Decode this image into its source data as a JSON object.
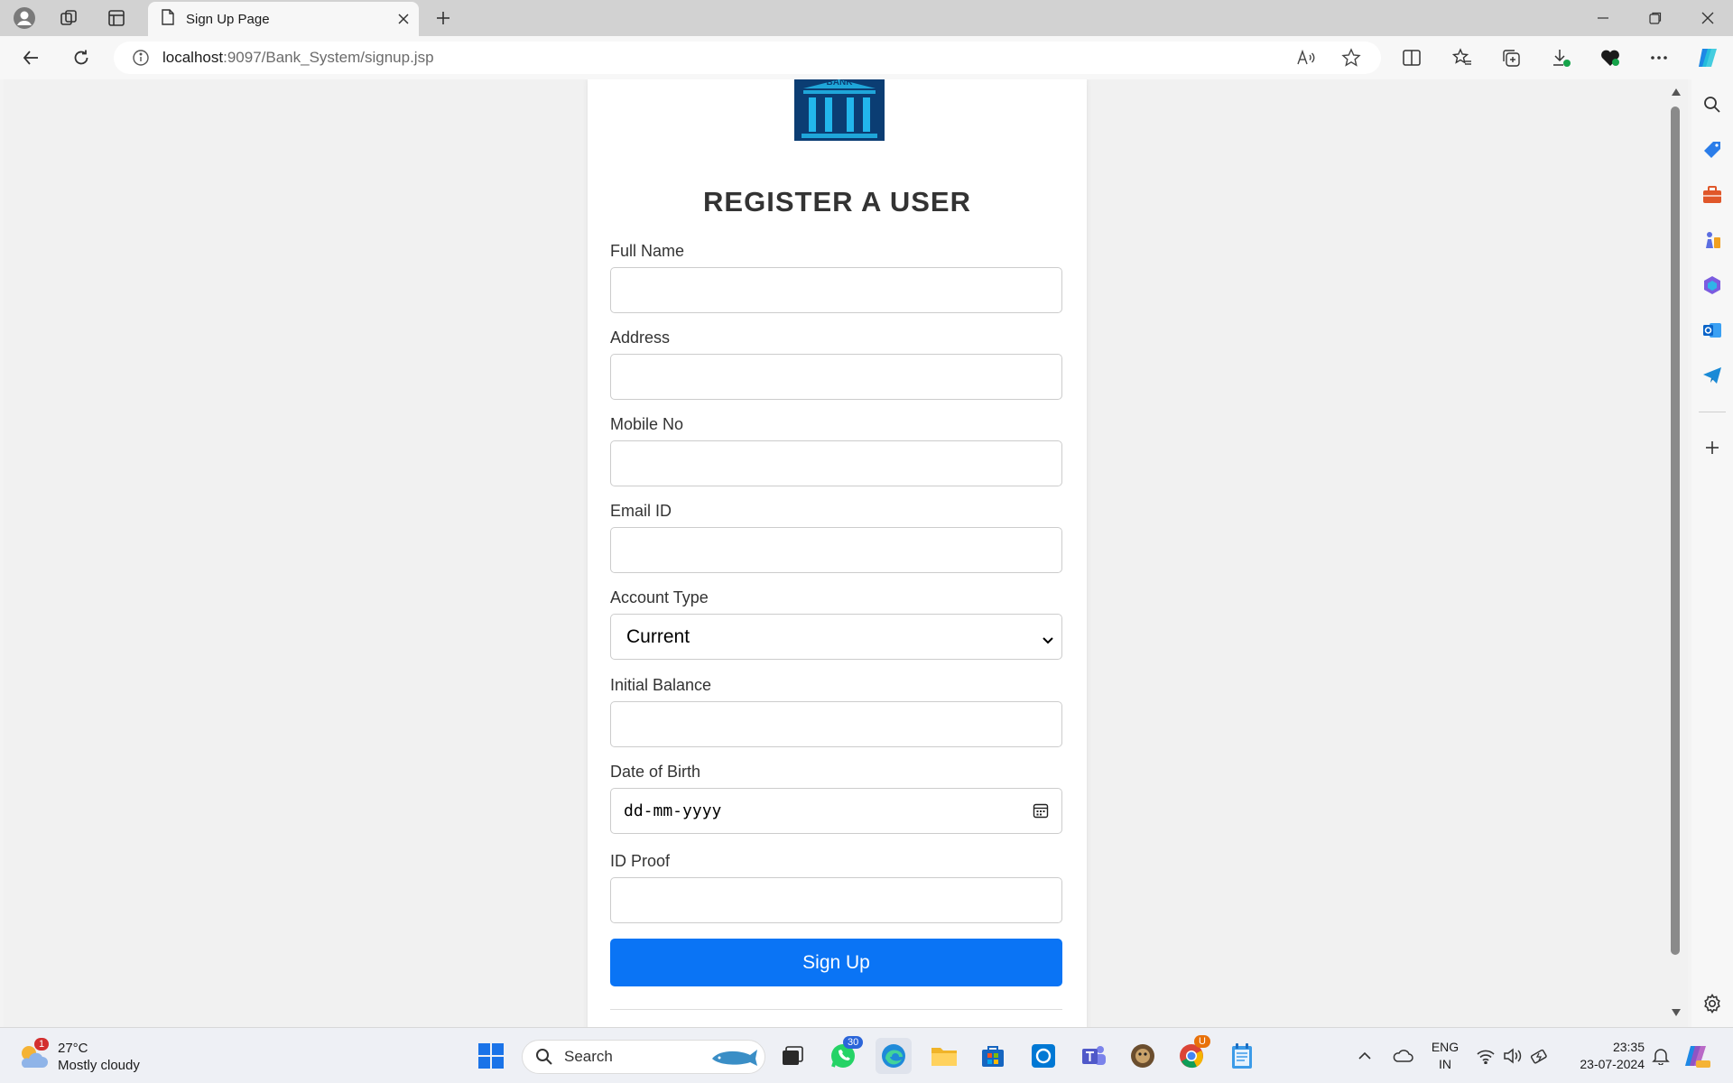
{
  "browser": {
    "tab_title": "Sign Up Page",
    "url_host": "localhost",
    "url_path": ":9097/Bank_System/signup.jsp"
  },
  "page": {
    "logo_text": "BANK",
    "heading": "REGISTER A USER",
    "fields": {
      "full_name": {
        "label": "Full Name",
        "value": ""
      },
      "address": {
        "label": "Address",
        "value": ""
      },
      "mobile": {
        "label": "Mobile No",
        "value": ""
      },
      "email": {
        "label": "Email ID",
        "value": ""
      },
      "account_type": {
        "label": "Account Type",
        "value": "Current"
      },
      "initial_balance": {
        "label": "Initial Balance",
        "value": ""
      },
      "dob": {
        "label": "Date of Birth",
        "placeholder": "dd-mm-yyyy"
      },
      "id_proof": {
        "label": "ID Proof",
        "value": ""
      }
    },
    "submit_label": "Sign Up"
  },
  "taskbar": {
    "weather_temp": "27°C",
    "weather_desc": "Mostly cloudy",
    "weather_badge": "1",
    "search_label": "Search",
    "whatsapp_badge": "30",
    "chrome_badge": "U",
    "lang_1": "ENG",
    "lang_2": "IN",
    "time": "23:35",
    "date": "23-07-2024"
  },
  "colors": {
    "accent": "#0a74f5",
    "tab_bar": "#d2d2d2",
    "logo_bg": "#0b3d73"
  }
}
